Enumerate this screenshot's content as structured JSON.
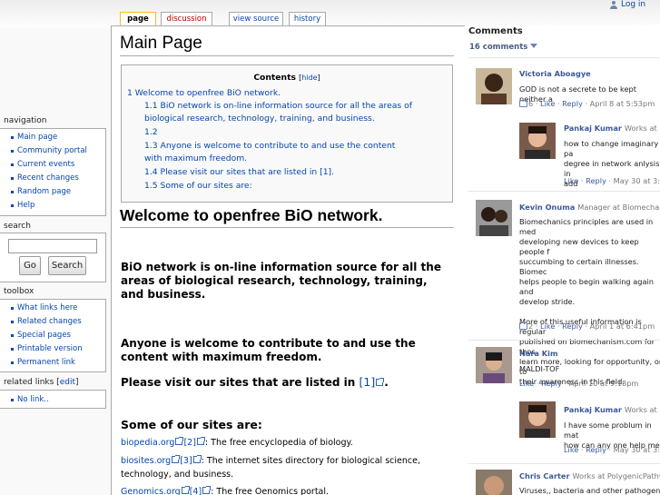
{
  "header": {
    "login_label": "Log in"
  },
  "tabs": [
    {
      "label": "page"
    },
    {
      "label": "discussion"
    },
    {
      "label": "view source"
    },
    {
      "label": "history"
    }
  ],
  "page": {
    "title": "Main Page",
    "toc": {
      "title": "Contents",
      "hide_label": "hide",
      "items": [
        "1 Welcome to openfree BiO network.",
        "1.1 BiO network is on-line information source for all the areas of biological research, technology, training, and business.",
        "1.2",
        "1.3 Anyone is welcome to contribute to and use the content with maximum freedom.",
        "1.4 Please visit our sites that are listed in [1].",
        "1.5 Some of our sites are:"
      ]
    },
    "heading": "Welcome to openfree BiO network.",
    "para1": "BiO network is on-line information source for all the areas of biological research, technology, training, and business.",
    "para2": "Anyone is welcome to contribute to and use the content with maximum freedom.",
    "para3_text": "Please visit our sites that are listed in ",
    "para3_ref": "[1]",
    "para3_end": ".",
    "sites_heading": "Some of our sites are:",
    "sites": [
      {
        "link": "biopedia.org",
        "ref": "[2]",
        "desc": ": The free encyclopedia of biology."
      },
      {
        "link": "biosites.org",
        "ref": "[3]",
        "desc": ": The internet sites directory for biological science, technology, and business."
      },
      {
        "link": "Genomics.org",
        "ref": "[4]",
        "desc": ": The free Oenomics portal."
      }
    ]
  },
  "sidebar": {
    "navigation": {
      "title": "navigation",
      "items": [
        "Main page",
        "Community portal",
        "Current events",
        "Recent changes",
        "Random page",
        "Help"
      ]
    },
    "search": {
      "title": "search",
      "go_label": "Go",
      "search_label": "Search"
    },
    "toolbox": {
      "title": "toolbox",
      "items": [
        "What links here",
        "Related changes",
        "Special pages",
        "Printable version",
        "Permanent link"
      ]
    },
    "related": {
      "title": "related links [",
      "edit_label": "edit",
      "title_end": "]",
      "items": [
        "No link.."
      ]
    }
  },
  "comments": {
    "title": "Comments",
    "count_label": "16 comments",
    "items": [
      {
        "name": "Victoria Aboagye",
        "meta": "",
        "text": "GOD is not a secrete to be kept neither a",
        "likes": "6",
        "like_label": "Like",
        "reply_label": "Reply",
        "time": "April 8 at 5:53pm"
      },
      {
        "name": "Pankaj Kumar",
        "meta": "Works at S",
        "text": "how to change imaginary pa\ndegree in network anlysis in\nadd",
        "likes": "",
        "like_label": "Like",
        "reply_label": "Reply",
        "time": "May 30 at 3:1"
      },
      {
        "name": "Kevin Onuma",
        "meta": "Manager at Biomechani",
        "text": "Biomechanics principles are used in med\ndeveloping new devices to keep people f\nsuccumbing to certain illnesses. Biomec\nhelps people to begin walking again and\ndevelop stride.\n\nMore of this useful information is regular\npublished on biomechanism.com for thos\nlearn more, looking for opportunity, or to\ntheir awareness in this field.",
        "likes": "2",
        "like_label": "Like",
        "reply_label": "Reply",
        "time": "April 1 at 6:41pm"
      },
      {
        "name": "Nara Kim",
        "meta": "",
        "text": "MALDI-TOF",
        "likes": "",
        "like_label": "Like",
        "reply_label": "Reply",
        "time": "April 10 at 9:18pm"
      },
      {
        "name": "Pankaj Kumar",
        "meta": "Works at S",
        "text": "I have some problum in mat\nhow can any one help me.",
        "likes": "",
        "like_label": "Like",
        "reply_label": "Reply",
        "time": "May 30 at 3:1"
      },
      {
        "name": "Chris Carter",
        "meta": "Works at PolygenicPathw",
        "text": "Viruses,, bacteria and other pathogens h",
        "likes": "",
        "like_label": "",
        "reply_label": "",
        "time": ""
      }
    ]
  },
  "colors": {
    "link": "#0645ad",
    "comment_name": "#3b5998",
    "selected_tab_border": "#fabd23",
    "new_link": "#ba0000"
  }
}
